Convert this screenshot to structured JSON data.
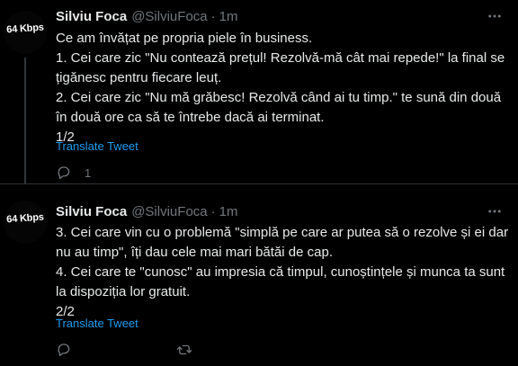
{
  "tweets": [
    {
      "avatar_text": "64 Kbps",
      "author_name": "Silviu Foca",
      "handle": "@SilviuFoca",
      "separator": "·",
      "time": "1m",
      "lines": [
        "Ce am învățat pe propria piele în business.",
        "1. Cei care zic \"Nu contează prețul! Rezolvă-mă cât mai repede!\" la final se",
        "țigănesc pentru fiecare leuț.",
        "2. Cei care zic \"Nu mă grăbesc! Rezolvă când ai tu timp.\" te sună din două",
        "în două ore ca să te întrebe dacă ai terminat.",
        "1/2"
      ],
      "translate_label": "Translate Tweet",
      "reply_count": "1"
    },
    {
      "avatar_text": "64 Kbps",
      "author_name": "Silviu Foca",
      "handle": "@SilviuFoca",
      "separator": "·",
      "time": "1m",
      "lines": [
        "3. Cei care vin cu o problemă \"simplă pe care ar putea să o rezolve și ei dar",
        "nu au timp\", îți dau cele mai mari bătăi de cap.",
        "4. Cei care te \"cunosc\" au impresia că timpul, cunoștințele și munca ta sunt",
        "la dispoziția lor gratuit.",
        "2/2"
      ],
      "translate_label": "Translate Tweet"
    }
  ],
  "icons": {
    "more": "more-horizontal-icon",
    "reply": "reply-icon",
    "retweet": "retweet-icon"
  },
  "colors": {
    "background": "#000000",
    "text": "#e7e9ea",
    "secondary": "#71767b",
    "link": "#1d9bf0",
    "divider": "#2f3336"
  }
}
